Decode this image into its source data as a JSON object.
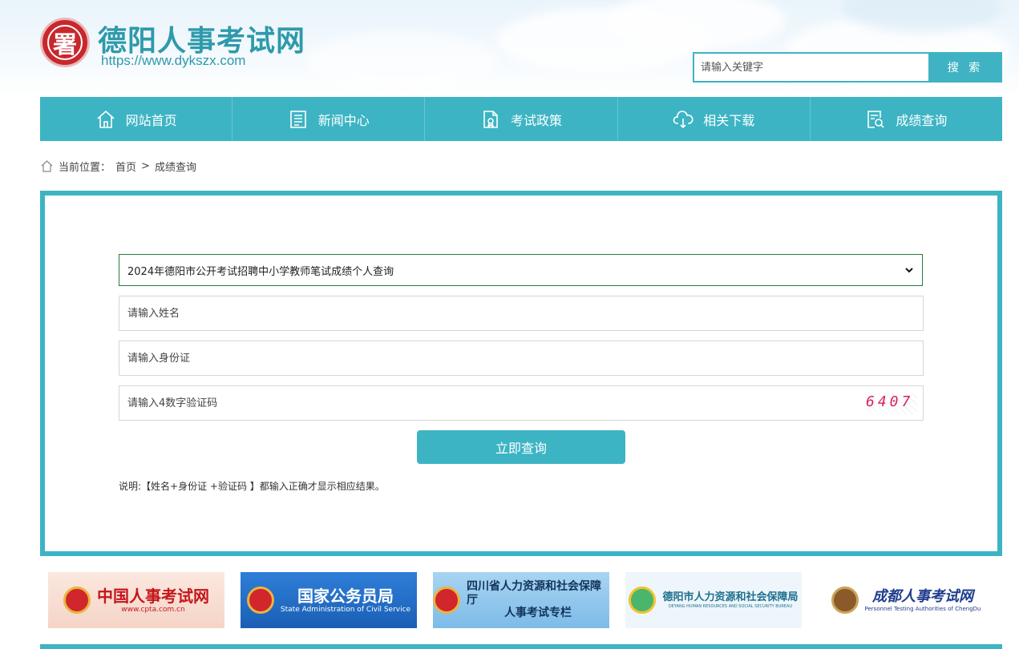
{
  "header": {
    "logo_text": "署",
    "site_title": "德阳人事考试网",
    "site_url": "https://www.dykszx.com",
    "search_placeholder": "请输入关键字",
    "search_button": "搜 索"
  },
  "nav": {
    "items": [
      {
        "label": "网站首页",
        "icon": "home-icon"
      },
      {
        "label": "新闻中心",
        "icon": "news-icon"
      },
      {
        "label": "考试政策",
        "icon": "policy-document-icon"
      },
      {
        "label": "相关下载",
        "icon": "cloud-download-icon"
      },
      {
        "label": "成绩查询",
        "icon": "search-document-icon"
      }
    ]
  },
  "breadcrumb": {
    "prefix": "当前位置：",
    "home": "首页",
    "separator": ">",
    "current": "成绩查询"
  },
  "form": {
    "exam_selected": "2024年德阳市公开考试招聘中小学教师笔试成绩个人查询",
    "name_placeholder": "请输入姓名",
    "id_placeholder": "请输入身份证",
    "code_placeholder": "请输入4数字验证码",
    "captcha": "6407",
    "submit": "立即查询",
    "note": "说明:【姓名+身份证 +验证码 】都输入正确才显示相应结果。"
  },
  "links": [
    {
      "main": "中国人事考试网",
      "sub": "www.cpta.com.cn"
    },
    {
      "main": "国家公务员局",
      "sub": "State Administration of Civil Service"
    },
    {
      "main": "四川省人力资源和社会保障厅",
      "sub": "人事考试专栏"
    },
    {
      "main": "德阳市人力资源和社会保障局",
      "sub": "DEYANG HUMAN RESOURCES AND SOCIAL SECURITY BUREAU"
    },
    {
      "main": "成都人事考试网",
      "sub": "Personnel Testing Authorities of ChengDu"
    }
  ],
  "colors": {
    "accent": "#3db4c4",
    "title": "#2e9aab",
    "captcha": "#d6245e"
  }
}
